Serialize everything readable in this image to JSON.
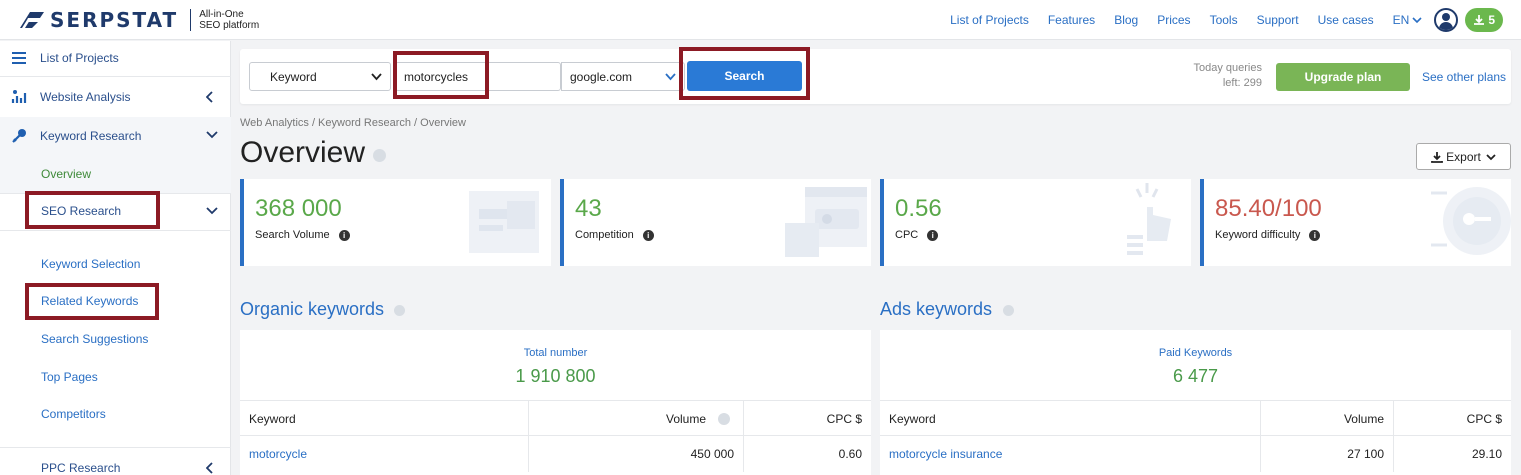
{
  "header": {
    "logo_text": "SERPSTAT",
    "logo_tagline_1": "All-in-One",
    "logo_tagline_2": "SEO platform",
    "nav": [
      "List of Projects",
      "Features",
      "Blog",
      "Prices",
      "Tools",
      "Support",
      "Use cases"
    ],
    "language": "EN",
    "downloads_count": "5"
  },
  "sidebar": {
    "list_of_projects": "List of Projects",
    "website_analysis": "Website Analysis",
    "keyword_research": "Keyword Research",
    "overview": "Overview",
    "seo_research": "SEO Research",
    "keyword_selection": "Keyword Selection",
    "related_keywords": "Related Keywords",
    "search_suggestions": "Search Suggestions",
    "top_pages": "Top Pages",
    "competitors": "Competitors",
    "ppc_research": "PPC Research"
  },
  "search": {
    "type": "Keyword",
    "query": "motorcycles",
    "database": "google.com",
    "button": "Search",
    "queries_label": "Today queries",
    "queries_left": "left: 299",
    "upgrade": "Upgrade plan",
    "other_plans": "See other plans"
  },
  "breadcrumb": "Web Analytics / Keyword Research / Overview",
  "page_title": "Overview",
  "export_label": "Export",
  "metrics": [
    {
      "value": "368 000",
      "label": "Search Volume"
    },
    {
      "value": "43",
      "label": "Competition"
    },
    {
      "value": "0.56",
      "label": "CPC"
    },
    {
      "value": "85.40/100",
      "label": "Keyword difficulty"
    }
  ],
  "organic": {
    "title": "Organic keywords",
    "total_label": "Total number",
    "total_value": "1 910 800",
    "columns": [
      "Keyword",
      "Volume",
      "CPC $"
    ],
    "rows": [
      {
        "keyword": "motorcycle",
        "volume": "450 000",
        "cpc": "0.60"
      }
    ]
  },
  "ads": {
    "title": "Ads keywords",
    "total_label": "Paid Keywords",
    "total_value": "6 477",
    "columns": [
      "Keyword",
      "Volume",
      "CPC $"
    ],
    "rows": [
      {
        "keyword": "motorcycle insurance",
        "volume": "27 100",
        "cpc": "29.10"
      }
    ]
  },
  "colors": {
    "brand": "#1f3a6b",
    "link": "#2a6fc4",
    "positive": "#5aa84a",
    "difficulty": "#c9584e",
    "highlight": "#8c1a24",
    "upgrade": "#7ab556"
  }
}
